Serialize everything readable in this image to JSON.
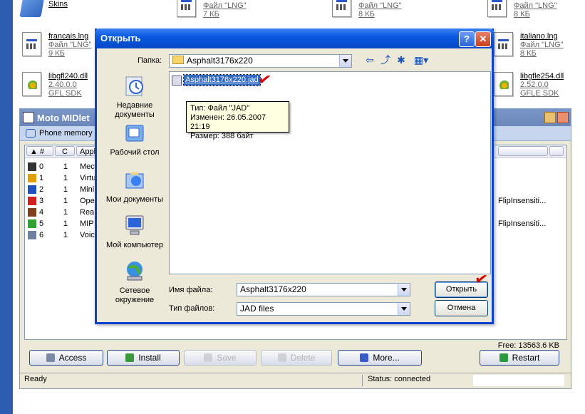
{
  "background": {
    "items": [
      {
        "name": "Skins",
        "sub1": "",
        "sub2": ""
      },
      {
        "name": "",
        "sub1": "Файл \"LNG\"",
        "sub2": "7 КБ"
      },
      {
        "name": "",
        "sub1": "Файл \"LNG\"",
        "sub2": "8 КБ"
      },
      {
        "name": "",
        "sub1": "Файл \"LNG\"",
        "sub2": "8 КБ"
      },
      {
        "name": "francais.lng",
        "sub1": "Файл \"LNG\"",
        "sub2": "9 КБ"
      },
      {
        "name": "italiano.lng",
        "sub1": "Файл \"LNG\"",
        "sub2": "8 КБ"
      },
      {
        "name": "libgfl240.dll",
        "sub1": "2.40.0.0",
        "sub2": "GFL SDK"
      },
      {
        "name": "libgfle254.dll",
        "sub1": "2.52.0.0",
        "sub2": "GFLE SDK"
      }
    ]
  },
  "moto": {
    "title": "Moto MIDlet",
    "phone_memory": "Phone memory",
    "columns": [
      "#",
      "C",
      "Appl"
    ],
    "rows": [
      {
        "num": "0",
        "c": "1",
        "app": "Mec",
        "flip": "",
        "color": "#333333"
      },
      {
        "num": "1",
        "c": "1",
        "app": "Virtu",
        "flip": "",
        "color": "#e0a000"
      },
      {
        "num": "2",
        "c": "1",
        "app": "Mini",
        "flip": "",
        "color": "#2050c0"
      },
      {
        "num": "3",
        "c": "1",
        "app": "Ope",
        "flip": "FlipInsensiti...",
        "color": "#d02020"
      },
      {
        "num": "4",
        "c": "1",
        "app": "Rea",
        "flip": "",
        "color": "#804020"
      },
      {
        "num": "5",
        "c": "1",
        "app": "MIP",
        "flip": "FlipInsensiti...",
        "color": "#30a030"
      },
      {
        "num": "6",
        "c": "1",
        "app": "Voic",
        "flip": "",
        "color": "#7080a0"
      }
    ],
    "free": "Free: 13563.6 KB",
    "buttons": {
      "access": "Access",
      "install": "Install",
      "save": "Save",
      "delete": "Delete",
      "more": "More...",
      "restart": "Restart"
    },
    "status_left": "Ready",
    "status_mid": "Status: connected"
  },
  "dialog": {
    "title": "Открыть",
    "help": "?",
    "close": "✕",
    "folder_label": "Папка:",
    "folder_value": "Asphalt3176x220",
    "places": [
      {
        "label": "Недавние документы",
        "icon": "recent-documents-icon"
      },
      {
        "label": "Рабочий стол",
        "icon": "desktop-icon"
      },
      {
        "label": "Мои документы",
        "icon": "my-documents-icon"
      },
      {
        "label": "Мой компьютер",
        "icon": "my-computer-icon"
      },
      {
        "label": "Сетевое окружение",
        "icon": "network-places-icon"
      }
    ],
    "file": "Asphalt3176x220.jad",
    "tooltip": {
      "type": "Тип: Файл \"JAD\"",
      "modified": "Изменен: 26.05.2007 21:19",
      "size": "Размер: 388 байт"
    },
    "filename_label": "Имя файла:",
    "filename_value": "Asphalt3176x220",
    "filetype_label": "Тип файлов:",
    "filetype_value": "JAD files",
    "open_button": "Открыть",
    "cancel_button": "Отмена"
  },
  "annotation": {
    "check_mark": "✔",
    "check_color": "#dd0000"
  }
}
